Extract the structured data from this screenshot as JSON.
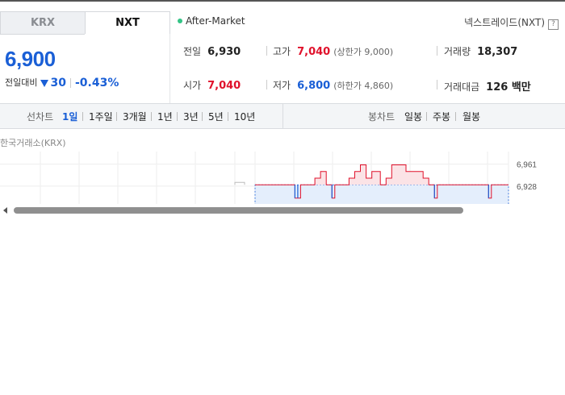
{
  "tabs": [
    {
      "label": "KRX",
      "active": false
    },
    {
      "label": "NXT",
      "active": true
    }
  ],
  "session": {
    "label": "After-Market",
    "dot_color": "#34c486"
  },
  "exchange": {
    "label": "넥스트레이드(NXT)",
    "help": "?"
  },
  "price": {
    "current": "6,900",
    "change_label": "전일대비",
    "change_amount": "30",
    "change_rate": "-0.43%",
    "direction": "down"
  },
  "stats": {
    "prev_close": {
      "label": "전일",
      "value": "6,930"
    },
    "high": {
      "label": "고가",
      "value": "7,040",
      "sub": "(상한가 9,000)"
    },
    "volume": {
      "label": "거래량",
      "value": "18,307"
    },
    "open": {
      "label": "시가",
      "value": "7,040"
    },
    "low": {
      "label": "저가",
      "value": "6,800",
      "sub": "(하한가 4,860)"
    },
    "amount": {
      "label": "거래대금",
      "value": "126 백만"
    }
  },
  "toolbar": {
    "line_label": "선차트",
    "line_periods": [
      "1일",
      "1주일",
      "3개월",
      "1년",
      "3년",
      "5년",
      "10년"
    ],
    "active_period": "1일",
    "candle_label": "봉차트",
    "candle_periods": [
      "일봉",
      "주봉",
      "월봉"
    ]
  },
  "chart": {
    "title": "한국거래소(KRX)",
    "y_ticks": [
      "6,961",
      "6,928"
    ],
    "colors": {
      "up": "#e0112b",
      "down": "#1a5fd6",
      "up_fill": "#fbe3e6",
      "down_fill": "#e4eefc",
      "grid": "#eeeeee"
    }
  },
  "chart_data": {
    "type": "line",
    "title": "",
    "ylabel": "",
    "ylim": [
      6900,
      6980
    ],
    "baseline": 6930,
    "y_ticks": [
      6961,
      6928
    ],
    "series": [
      {
        "values": [
          6930,
          6930,
          6930,
          6930,
          6930,
          6930,
          6930,
          6930,
          6930,
          6930,
          6930,
          6930,
          6930,
          6930,
          6910,
          6910,
          6930,
          6930,
          6930,
          6930,
          6930,
          6940,
          6940,
          6950,
          6950,
          6930,
          6930,
          6910,
          6930,
          6930,
          6930,
          6930,
          6930,
          6940,
          6940,
          6950,
          6950,
          6960,
          6960,
          6940,
          6940,
          6950,
          6950,
          6950,
          6930,
          6930,
          6940,
          6940,
          6960,
          6960,
          6960,
          6960,
          6960,
          6950,
          6950,
          6950,
          6950,
          6950,
          6950,
          6940,
          6940,
          6930,
          6930,
          6910,
          6930,
          6930,
          6930,
          6930,
          6930,
          6930,
          6930,
          6930,
          6930,
          6930,
          6930,
          6930,
          6930,
          6930,
          6930,
          6930,
          6930,
          6930,
          6910,
          6930,
          6930,
          6930,
          6930,
          6930,
          6930,
          6930
        ]
      }
    ]
  }
}
